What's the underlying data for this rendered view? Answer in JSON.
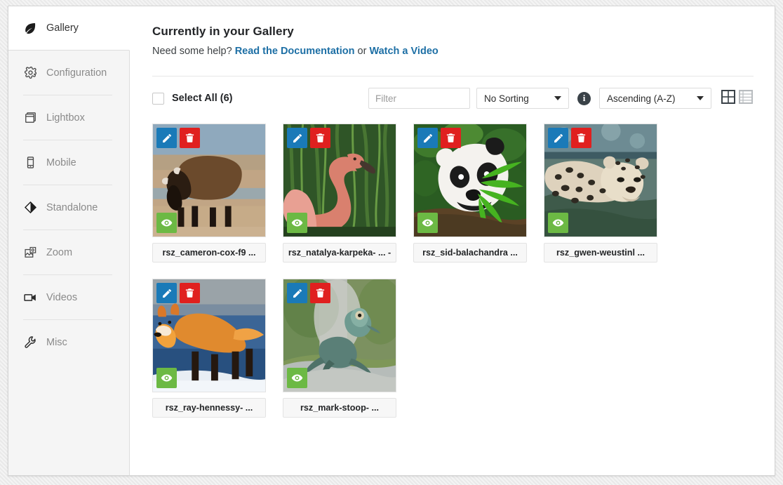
{
  "sidebar": {
    "items": [
      {
        "label": "Gallery",
        "icon": "leaf-icon",
        "active": true
      },
      {
        "label": "Configuration",
        "icon": "gear-icon",
        "active": false
      },
      {
        "label": "Lightbox",
        "icon": "lightbox-icon",
        "active": false
      },
      {
        "label": "Mobile",
        "icon": "mobile-icon",
        "active": false
      },
      {
        "label": "Standalone",
        "icon": "diamond-icon",
        "active": false
      },
      {
        "label": "Zoom",
        "icon": "zoom-image-icon",
        "active": false
      },
      {
        "label": "Videos",
        "icon": "video-camera-icon",
        "active": false
      },
      {
        "label": "Misc",
        "icon": "wrench-icon",
        "active": false
      }
    ]
  },
  "header": {
    "title": "Currently in your Gallery",
    "help_prefix": "Need some help? ",
    "help_link_1": "Read the Documentation",
    "help_middle": " or ",
    "help_link_2": "Watch a Video"
  },
  "toolbar": {
    "select_all_label": "Select All (6)",
    "filter_placeholder": "Filter",
    "filter_value": "",
    "sorting_value": "No Sorting",
    "direction_value": "Ascending (A-Z)",
    "info_icon": "info-icon",
    "grid_view_icon": "grid-view-icon",
    "list_view_icon": "list-view-icon",
    "active_view": "grid"
  },
  "gallery": {
    "items": [
      {
        "caption": "rsz_cameron-cox-f9 ...",
        "subject": "bison",
        "edit": "edit-icon",
        "delete": "trash-icon",
        "view": "eye-icon"
      },
      {
        "caption": "rsz_natalya-karpeka- ... -",
        "subject": "flamingo",
        "edit": "edit-icon",
        "delete": "trash-icon",
        "view": "eye-icon"
      },
      {
        "caption": "rsz_sid-balachandra ...",
        "subject": "panda",
        "edit": "edit-icon",
        "delete": "trash-icon",
        "view": "eye-icon"
      },
      {
        "caption": "rsz_gwen-weustinl ...",
        "subject": "leopard",
        "edit": "edit-icon",
        "delete": "trash-icon",
        "view": "eye-icon"
      },
      {
        "caption": "rsz_ray-hennessy- ...",
        "subject": "fox",
        "edit": "edit-icon",
        "delete": "trash-icon",
        "view": "eye-icon"
      },
      {
        "caption": "rsz_mark-stoop-  ...",
        "subject": "frog",
        "edit": "edit-icon",
        "delete": "trash-icon",
        "view": "eye-icon"
      }
    ]
  },
  "colors": {
    "edit_blue": "#1a7ab8",
    "delete_red": "#e0201f",
    "view_green": "#6cb944",
    "link_blue": "#1d6fa5",
    "sidebar_bg": "#f5f5f5",
    "info_dark": "#3a4248"
  }
}
